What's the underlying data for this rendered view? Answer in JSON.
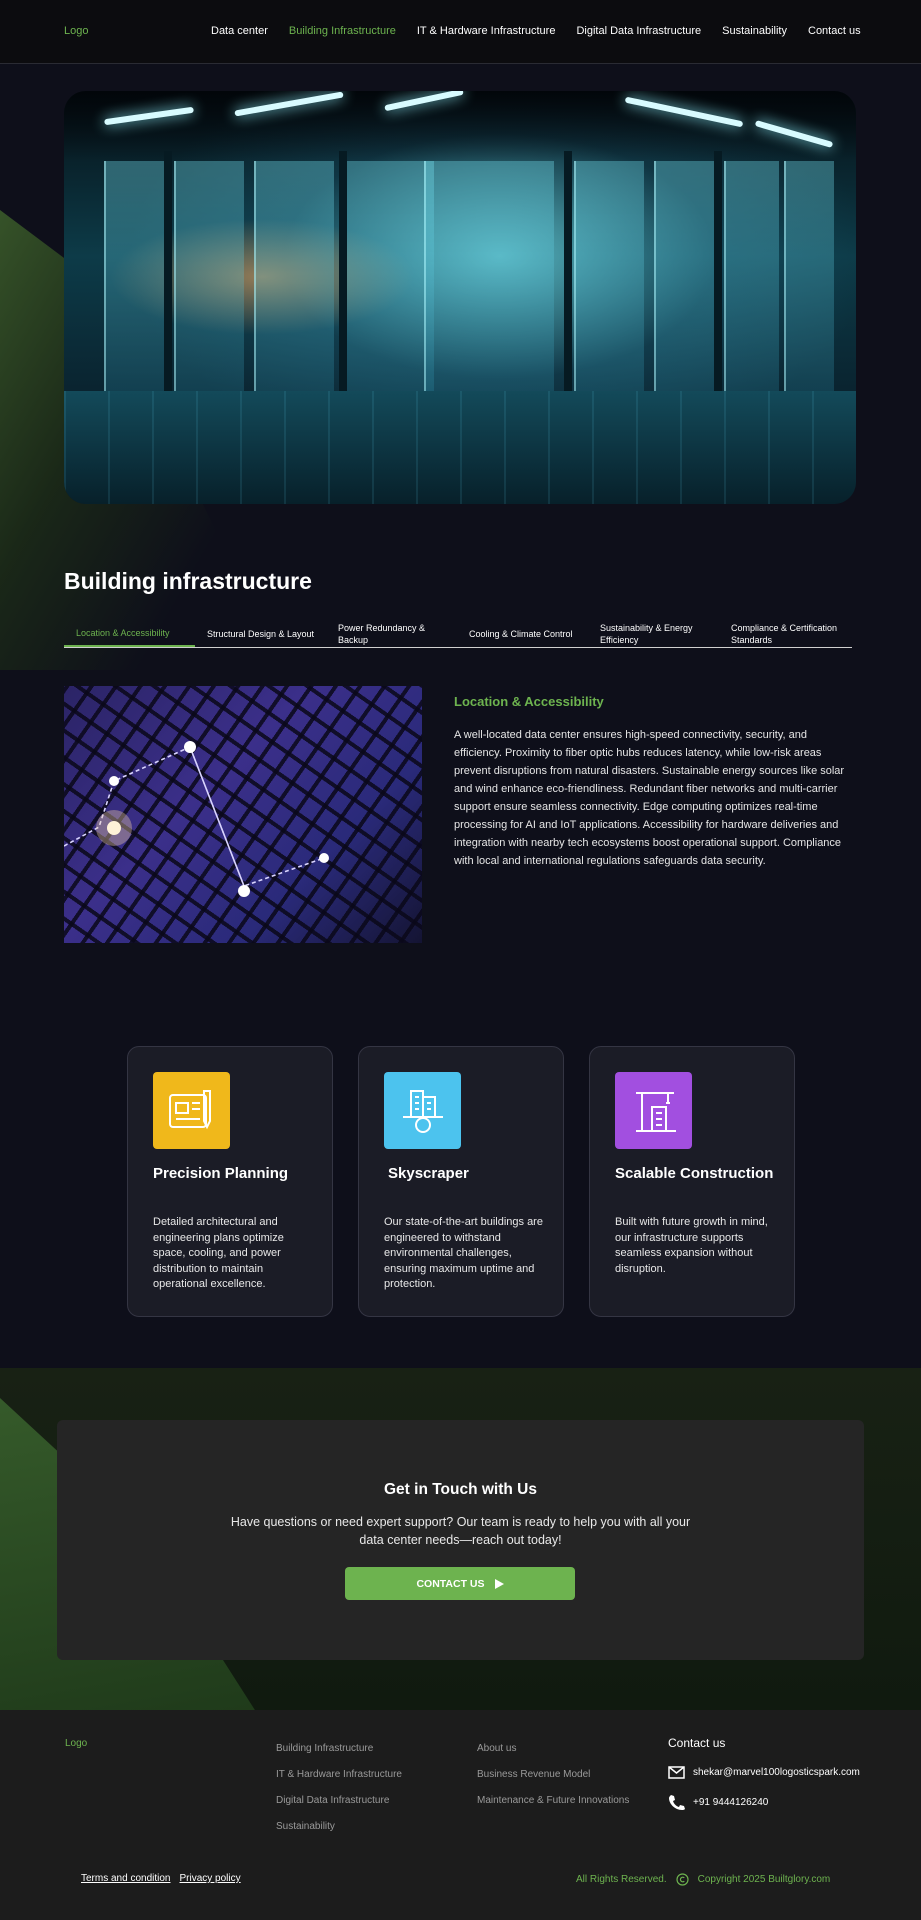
{
  "header": {
    "logo": "Logo",
    "nav": [
      "Data center",
      "Building Infrastructure",
      "IT & Hardware Infrastructure",
      "Digital Data Infrastructure",
      "Sustainability",
      "Contact us"
    ],
    "active_nav": "Building Infrastructure"
  },
  "section": {
    "title": "Building infrastructure",
    "tabs": [
      "Location & Accessibility",
      "Structural Design & Layout",
      "Power Redundancy & Backup",
      "Cooling & Climate Control",
      "Sustainability & Energy Efficiency",
      "Compliance & Certification Standards"
    ],
    "active_tab": "Location & Accessibility"
  },
  "detail": {
    "title": "Location & Accessibility",
    "text": "A well-located data center ensures high-speed connectivity, security, and efficiency. Proximity to fiber optic hubs reduces latency, while low-risk areas prevent disruptions from natural disasters. Sustainable energy sources like solar and wind enhance eco-friendliness. Redundant fiber networks and multi-carrier support ensure seamless connectivity. Edge computing optimizes real-time processing for AI and IoT applications. Accessibility for hardware deliveries and integration with nearby tech ecosystems boost operational support. Compliance with local and international regulations safeguards data security."
  },
  "features": [
    {
      "title": "Precision Planning",
      "text": "Detailed architectural and engineering plans optimize space, cooling, and power distribution to maintain operational excellence.",
      "icon": "blueprint-icon",
      "color": "#f0b81b"
    },
    {
      "title": "Skyscraper",
      "text": "Our state-of-the-art buildings are engineered to withstand environmental challenges, ensuring maximum uptime and protection.",
      "icon": "skyscraper-icon",
      "color": "#4cc3ee"
    },
    {
      "title": "Scalable Construction",
      "text": "Built with future growth in mind, our infrastructure supports seamless expansion without disruption.",
      "icon": "crane-icon",
      "color": "#a24fe0"
    }
  ],
  "contact": {
    "title": "Get in Touch with Us",
    "text": "Have questions or need expert support? Our team is ready to help you with all your data center needs—reach out today!",
    "button": "CONTACT US"
  },
  "footer": {
    "logo": "Logo",
    "col1": [
      "Building Infrastructure",
      "IT & Hardware Infrastructure",
      "Digital Data Infrastructure",
      "Sustainability"
    ],
    "col2": [
      "About us",
      "Business Revenue Model",
      "Maintenance & Future Innovations"
    ],
    "contact_title": "Contact us",
    "email": "shekar@marvel100logosticspark.com",
    "phone": "+91 9444126240",
    "terms": "Terms and condition",
    "privacy": "Privacy policy",
    "rights": "All Rights Reserved.",
    "copyright": "Copyright 2025 Builtglory.com"
  },
  "colors": {
    "accent": "#6db34f",
    "background": "#0e0f1a",
    "card": "#1b1c26",
    "footer": "#1c1c1c"
  }
}
